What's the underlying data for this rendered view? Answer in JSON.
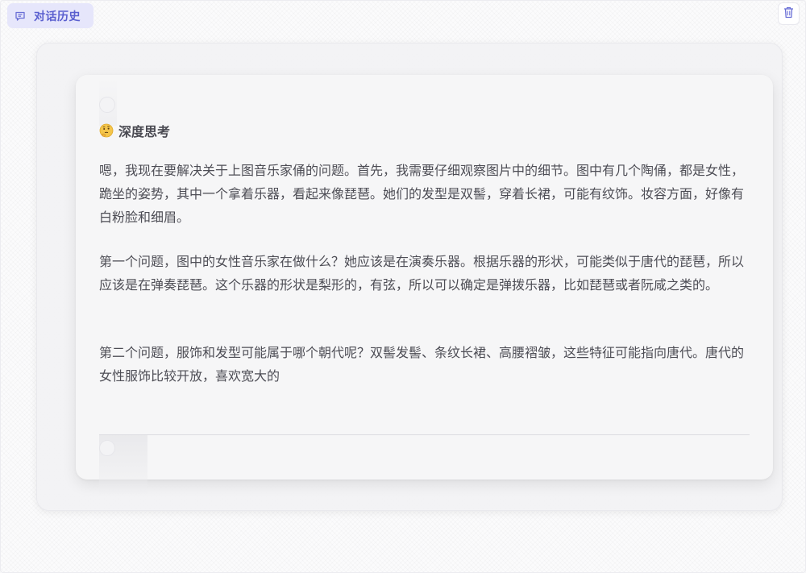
{
  "header": {
    "history_label": "对话历史",
    "history_icon": "chat-bubble-icon",
    "delete_icon": "trash-icon",
    "accent_color": "#5a5fcf"
  },
  "thinking": {
    "emoji_icon": "thinking-face-icon",
    "title": "深度思考",
    "paragraphs": [
      "嗯，我现在要解决关于上图音乐家俑的问题。首先，我需要仔细观察图片中的细节。图中有几个陶俑，都是女性，跪坐的姿势，其中一个拿着乐器，看起来像琵琶。她们的发型是双髻，穿着长裙，可能有纹饰。妆容方面，好像有白粉脸和细眉。",
      "第一个问题，图中的女性音乐家在做什么？她应该是在演奏乐器。根据乐器的形状，可能类似于唐代的琵琶，所以应该是在弹奏琵琶。这个乐器的形状是梨形的，有弦，所以可以确定是弹拨乐器，比如琵琶或者阮咸之类的。",
      "第二个问题，服饰和发型可能属于哪个朝代呢？双髻发髻、条纹长裙、高腰褶皱，这些特征可能指向唐代。唐代的女性服饰比较开放，喜欢宽大的"
    ]
  }
}
